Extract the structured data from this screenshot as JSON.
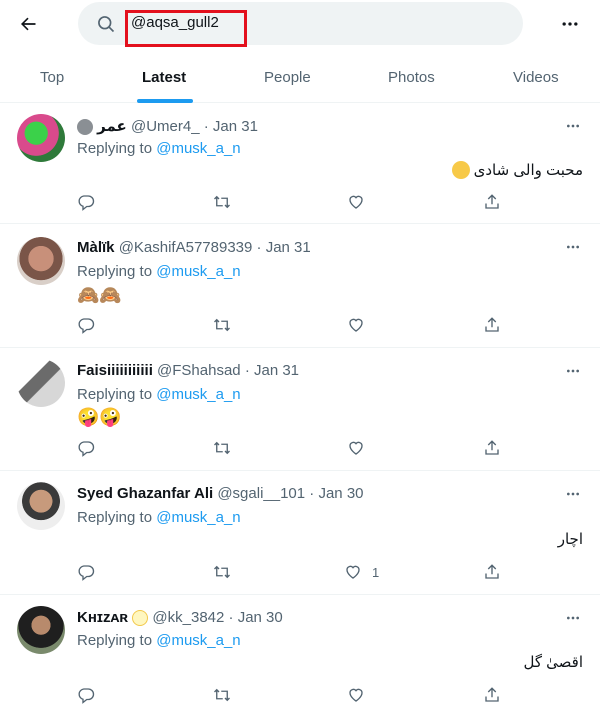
{
  "header": {
    "search_value": "@aqsa_gull2",
    "icons": {
      "back": "arrow-left-icon",
      "search": "search-icon",
      "more": "more-horizontal-icon"
    },
    "highlight_color": "#e3101d"
  },
  "tabs": [
    {
      "label": "Top",
      "active": false
    },
    {
      "label": "Latest",
      "active": true
    },
    {
      "label": "People",
      "active": false
    },
    {
      "label": "Photos",
      "active": false
    },
    {
      "label": "Videos",
      "active": false
    }
  ],
  "colors": {
    "accent": "#1d9bf0",
    "text": "#0f1419",
    "muted": "#536471",
    "divider": "#eff3f4"
  },
  "tweets": [
    {
      "name": "عمر",
      "handle": "@Umer4_",
      "date": "Jan 31",
      "replying_label": "Replying to",
      "replying_to": "@musk_a_n",
      "body": "محبت والی شادی",
      "body_emoji": "sweat-smile-emoji",
      "like_count": ""
    },
    {
      "name": "Màlïk",
      "handle": "@KashifA57789339",
      "date": "Jan 31",
      "replying_label": "Replying to",
      "replying_to": "@musk_a_n",
      "body": "🙈🙈",
      "like_count": ""
    },
    {
      "name": "Faisiiiiiiiiiii",
      "handle": "@FShahsad",
      "date": "Jan 31",
      "replying_label": "Replying to",
      "replying_to": "@musk_a_n",
      "body": "🤪🤪",
      "like_count": ""
    },
    {
      "name": "Syed Ghazanfar Ali",
      "handle": "@sgali__101",
      "date": "Jan 30",
      "replying_label": "Replying to",
      "replying_to": "@musk_a_n",
      "body": "اچار",
      "like_count": "1"
    },
    {
      "name": "Kʜɪᴢᴀʀ",
      "handle": "@kk_3842",
      "date": "Jan 30",
      "replying_label": "Replying to",
      "replying_to": "@musk_a_n",
      "body": "اقصیٰ گل",
      "like_count": ""
    }
  ],
  "action_icons": [
    "reply-icon",
    "retweet-icon",
    "like-icon",
    "share-icon"
  ]
}
